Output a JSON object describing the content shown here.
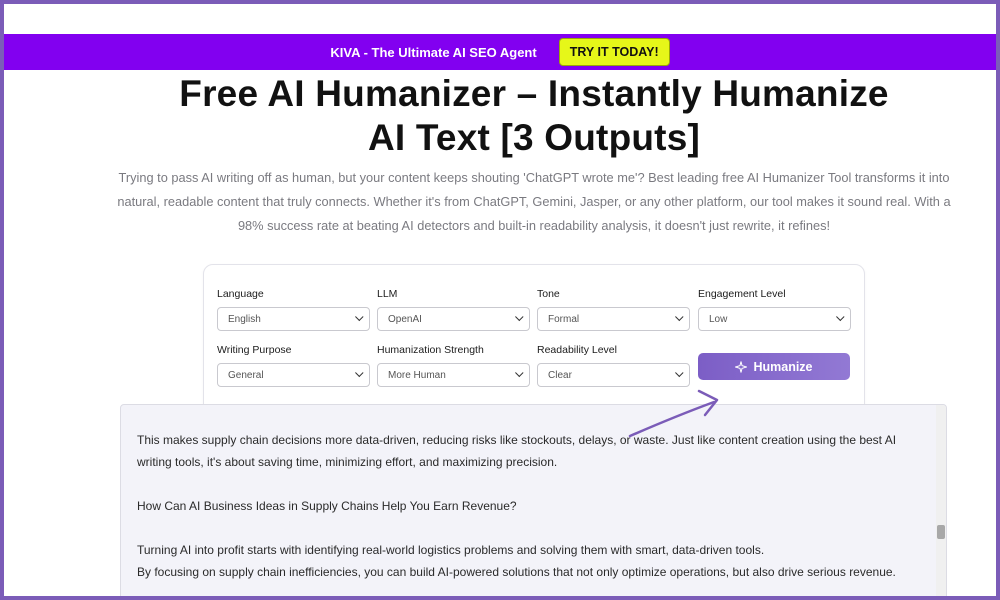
{
  "promo": {
    "text": "KIVA - The Ultimate AI SEO Agent",
    "cta": "TRY IT TODAY!"
  },
  "page": {
    "title_line1": "Free AI Humanizer – Instantly Humanize",
    "title_line2": "AI Text [3 Outputs]",
    "description": "Trying to pass AI writing off as human, but your content keeps shouting 'ChatGPT wrote me'? Best leading free AI Humanizer Tool transforms it into natural, readable content that truly connects. Whether it's from ChatGPT, Gemini, Jasper, or any other platform, our tool makes it sound real. With a 98% success rate at beating AI detectors and built-in readability analysis, it doesn't just rewrite, it refines!"
  },
  "options": {
    "language": {
      "label": "Language",
      "value": "English"
    },
    "llm": {
      "label": "LLM",
      "value": "OpenAI"
    },
    "tone": {
      "label": "Tone",
      "value": "Formal"
    },
    "engagement": {
      "label": "Engagement Level",
      "value": "Low"
    },
    "purpose": {
      "label": "Writing Purpose",
      "value": "General"
    },
    "strength": {
      "label": "Humanization Strength",
      "value": "More Human"
    },
    "readability": {
      "label": "Readability Level",
      "value": "Clear"
    },
    "humanize_label": "Humanize"
  },
  "output": {
    "para1_line1": "This makes supply chain decisions more data-driven, reducing risks like stockouts, delays, or waste. Just like content creation using the best AI",
    "para1_line2": "writing tools, it's about saving time, minimizing effort, and maximizing precision.",
    "heading": "How Can AI Business Ideas in Supply Chains Help You Earn Revenue?",
    "para2_line1": "Turning AI into profit starts with identifying real-world logistics problems and solving them with smart, data-driven tools.",
    "para2_line2": "By focusing on supply chain inefficiencies, you can build AI-powered solutions that not only optimize operations, but also drive serious revenue."
  },
  "colors": {
    "promo_bg": "#8200f0",
    "cta_bg": "#e6f719",
    "accent": "#7c5ec6",
    "frame": "#7b5cb8"
  }
}
